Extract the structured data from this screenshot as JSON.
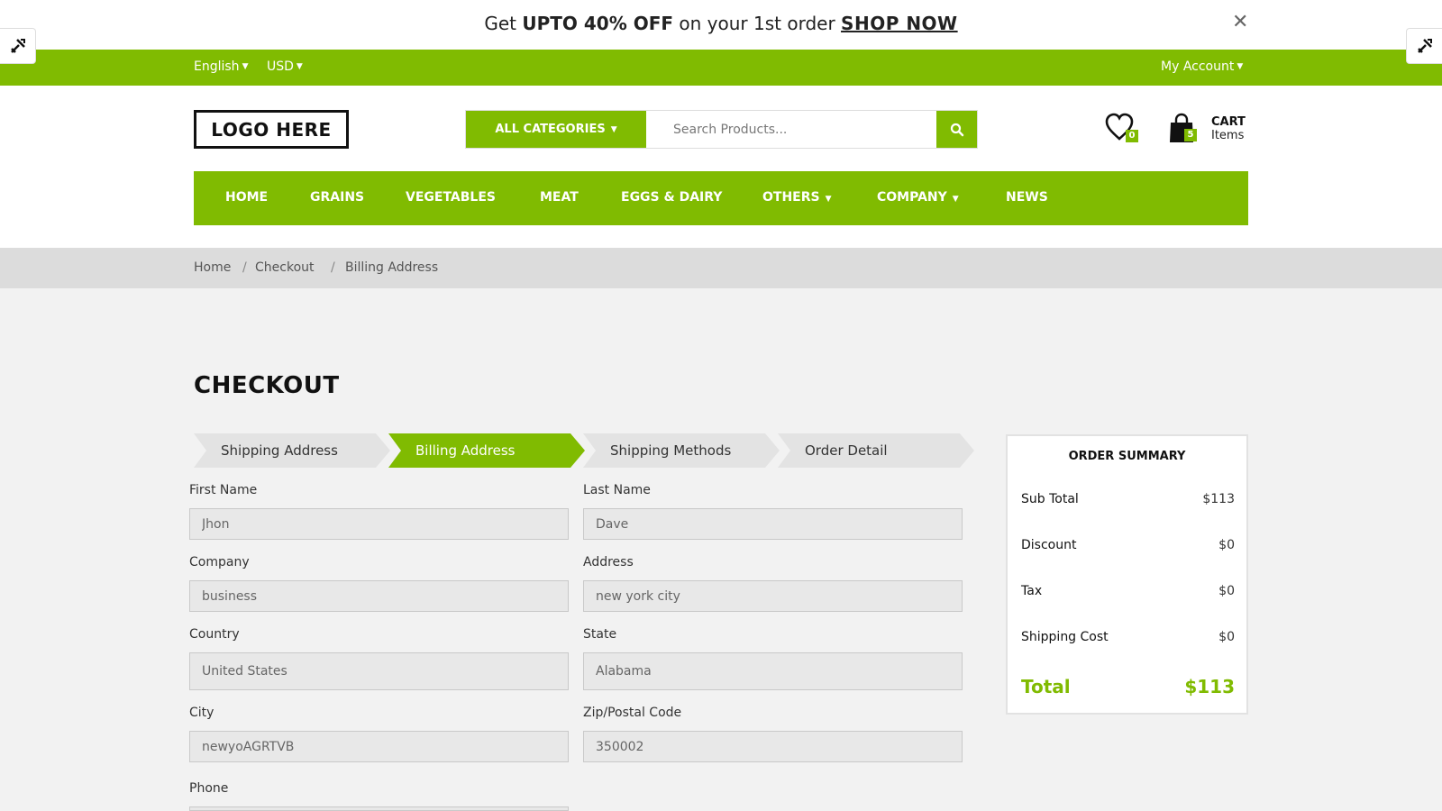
{
  "promo": {
    "prefix": "Get ",
    "bold": "UPTO 40% OFF",
    "middle": " on your 1st order ",
    "link": "SHOP NOW",
    "close": "✕"
  },
  "topbar": {
    "language": "English",
    "currency": "USD",
    "account": "My Account"
  },
  "header": {
    "logo": "LOGO HERE",
    "categories_button": "ALL CATEGORIES",
    "search_placeholder": "Search Products...",
    "wishlist_count": "0",
    "cart_count": "5",
    "cart_title": "CART",
    "cart_subtitle": "Items"
  },
  "nav": {
    "items": [
      "HOME",
      "GRAINS",
      "VEGETABLES",
      "MEAT",
      "EGGS & DAIRY",
      "OTHERS",
      "COMPANY",
      "NEWS"
    ]
  },
  "breadcrumb": [
    "Home",
    "Checkout",
    "Billing Address"
  ],
  "checkout": {
    "title": "CHECKOUT",
    "steps": [
      "Shipping Address",
      "Billing Address",
      "Shipping Methods",
      "Order Detail"
    ],
    "active_step": "Billing Address",
    "fields": {
      "first_name": {
        "label": "First Name",
        "value": "Jhon"
      },
      "last_name": {
        "label": "Last Name",
        "value": "Dave"
      },
      "company": {
        "label": "Company",
        "value": "business"
      },
      "address": {
        "label": "Address",
        "value": "new york city"
      },
      "country": {
        "label": "Country",
        "value": "United States"
      },
      "state": {
        "label": "State",
        "value": "Alabama"
      },
      "city": {
        "label": "City",
        "value": "newyoAGRTVB"
      },
      "zip": {
        "label": "Zip/Postal Code",
        "value": "350002"
      },
      "phone": {
        "label": "Phone",
        "value": ""
      }
    }
  },
  "summary": {
    "title": "ORDER SUMMARY",
    "rows": [
      {
        "label": "Sub Total",
        "value": "$113"
      },
      {
        "label": "Discount",
        "value": "$0"
      },
      {
        "label": "Tax",
        "value": "$0"
      },
      {
        "label": "Shipping Cost",
        "value": "$0"
      }
    ],
    "total_label": "Total",
    "total_value": "$113"
  },
  "colors": {
    "accent": "#80bb01",
    "breadcrumb_bg": "#dcdcdc",
    "page_bg": "#f2f2f2"
  }
}
